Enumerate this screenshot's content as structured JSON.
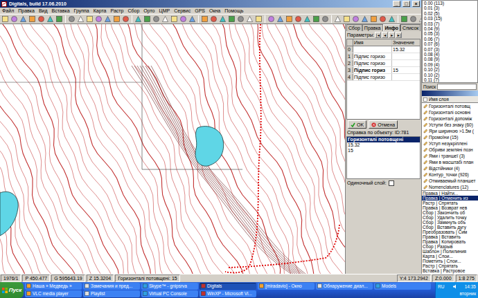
{
  "window": {
    "title": "Digitals, build 17.06.2010",
    "controls": [
      "_",
      "□",
      "×"
    ]
  },
  "menu": [
    "Файл",
    "Правка",
    "Вид",
    "Вставка",
    "Группа",
    "Карта",
    "Растр",
    "Сбор",
    "Орто",
    "ЦМР",
    "Сервис",
    "GPS",
    "Окна",
    "Помощь"
  ],
  "panel": {
    "tabs": [
      {
        "label": "Сбор",
        "selected": false
      },
      {
        "label": "Правка",
        "selected": false
      },
      {
        "label": "Инфо",
        "selected": true
      },
      {
        "label": "Список",
        "selected": false
      }
    ],
    "params_label": "Параметры:",
    "nav": [
      "|◄",
      "◄",
      "►",
      "►|"
    ],
    "table": {
      "columns": [
        "Имя",
        "Значение"
      ],
      "rows": [
        {
          "index": "0",
          "name": "",
          "value": "15.32",
          "selected": false
        },
        {
          "index": "1",
          "name": "Підпис горизо",
          "value": "",
          "selected": false
        },
        {
          "index": "2",
          "name": "Підпис горизо",
          "value": "",
          "selected": false
        },
        {
          "index": "3",
          "name": "Підпис гориз",
          "value": "15",
          "selected": true
        },
        {
          "index": "4",
          "name": "Підпис горизо",
          "value": "",
          "selected": false
        }
      ]
    },
    "buttons": [
      {
        "label": "OK",
        "kind": "ok"
      },
      {
        "label": "Отмена",
        "kind": "cancel"
      }
    ],
    "info": {
      "title": "Справка по объекту: ID:781",
      "lines": [
        {
          "text": "Горизонталі потовщені",
          "selected": true
        },
        {
          "text": "15.32",
          "selected": false
        },
        {
          "text": "15",
          "selected": false
        }
      ]
    },
    "single_layer": {
      "label": "Одиночный слой:",
      "checked": false
    }
  },
  "values": [
    "0.00 (113)",
    "0.01 (3)",
    "0.02 (5)",
    "0.03 (15)",
    "0.03 (7)",
    "0.04 (9)",
    "0.05 (3)",
    "0.06 (7)",
    "0.07 (6)",
    "0.07 (3)",
    "0.08 (4)",
    "0.08 (9)",
    "0.09 (4)",
    "0.10 (2)",
    "0.10 (2)",
    "0.11 (7)"
  ],
  "search": {
    "label": "Поиск"
  },
  "layers": {
    "column": "Имя слоя",
    "items": [
      "Горизонталі потовщ",
      "Горизонталі основні",
      "Горизонталі допоміж",
      "Уступи без знаку (60)",
      "Яри шириною >1.5м (",
      "Промоїни (15)",
      "Уступ незукріплені",
      "Обриви земляні позн",
      "Ями і траншеї (3)",
      "Ями в масштабі план",
      "Відстійники (4)",
      "Контур_точки (926)",
      "Отмиваемый планшет",
      "Nomenclatures (12)"
    ]
  },
  "history": [
    {
      "text": "Правка | Найти...",
      "selected": false
    },
    {
      "text": "Правка | Отменить из",
      "selected": true
    },
    {
      "text": "Растр | Спрятать",
      "selected": false
    },
    {
      "text": "Правка | Возврат нев",
      "selected": false
    },
    {
      "text": "Сбор | Закончить об",
      "selected": false
    },
    {
      "text": "Сбор | Удалить точку",
      "selected": false
    },
    {
      "text": "Сбор | Замкнуть объ",
      "selected": false
    },
    {
      "text": "Сбор | Вставить дугу",
      "selected": false
    },
    {
      "text": "Преобразовать | Сим",
      "selected": false
    },
    {
      "text": "Правка | Вставить",
      "selected": false
    },
    {
      "text": "Правка | Копировать",
      "selected": false
    },
    {
      "text": "Сбор | Разрыв",
      "selected": false
    },
    {
      "text": "Шаблон | Полилиния",
      "selected": false
    },
    {
      "text": "Карта | Слои...",
      "selected": false
    },
    {
      "text": "Пометить | Слои...",
      "selected": false
    },
    {
      "text": "Растр | Спрятать",
      "selected": false
    },
    {
      "text": "Вставка | Растровое",
      "selected": false
    }
  ],
  "status_bar": {
    "left": [
      "1976/1",
      "P 450.477",
      "G 595643.19",
      "Z 15.3204",
      "Горизонталі потовщені: 15"
    ],
    "right": [
      "Y:4 173.2942",
      "Z:0.000",
      "1:8 275"
    ]
  },
  "taskbar": {
    "start": "Пуск",
    "top_row": [
      {
        "label": "Наша » Медведь »",
        "selected": false
      },
      {
        "label": "Замечания и пред...",
        "selected": false
      },
      {
        "label": "Skype™ - gnipsrva",
        "selected": false
      },
      {
        "label": "Digitals",
        "selected": true
      },
      {
        "label": "[miradavio] - Окно",
        "selected": false
      },
      {
        "label": "Обнаружение диал...",
        "selected": false
      },
      {
        "label": "Models",
        "selected": false
      }
    ],
    "bottom_row": [
      {
        "label": "VLC media player",
        "selected": false
      },
      {
        "label": "Playlist",
        "selected": false
      },
      {
        "label": "Virtual PC Console",
        "selected": false
      },
      {
        "label": "WinXP - Microsoft Vi...",
        "selected": false
      }
    ],
    "tray": {
      "lang": "RU",
      "time": "14:35",
      "day": "вторник"
    }
  }
}
